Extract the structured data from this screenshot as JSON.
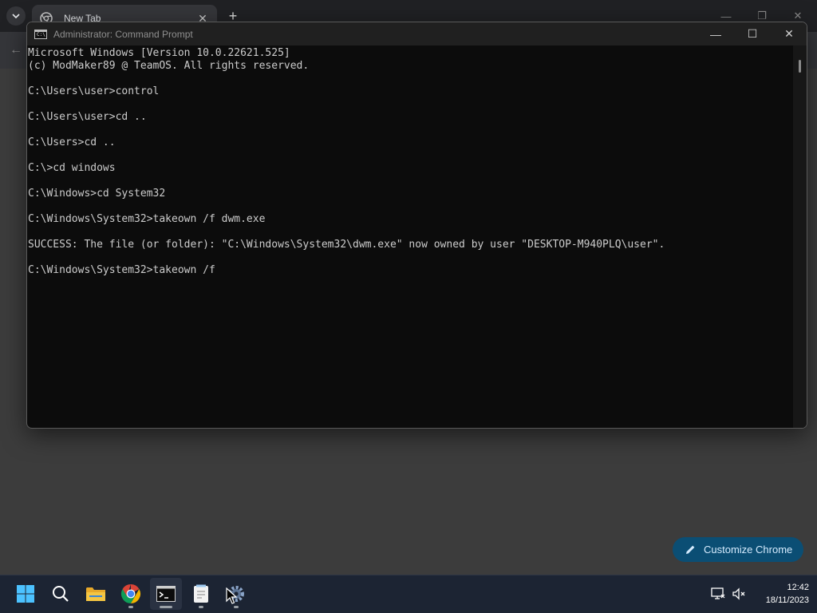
{
  "chrome": {
    "tab_title": "New Tab",
    "tab_close": "✕",
    "new_tab": "+",
    "back": "←",
    "win_minimize": "—",
    "win_restore": "❐",
    "win_close": "✕",
    "customize_label": "Customize Chrome"
  },
  "cmd": {
    "title": "Administrator: Command Prompt",
    "minimize": "—",
    "maximize": "☐",
    "close": "✕",
    "lines": [
      "Microsoft Windows [Version 10.0.22621.525]",
      "(c) ModMaker89 @ TeamOS. All rights reserved.",
      "",
      "C:\\Users\\user>control",
      "",
      "C:\\Users\\user>cd ..",
      "",
      "C:\\Users>cd ..",
      "",
      "C:\\>cd windows",
      "",
      "C:\\Windows>cd System32",
      "",
      "C:\\Windows\\System32>takeown /f dwm.exe",
      "",
      "SUCCESS: The file (or folder): \"C:\\Windows\\System32\\dwm.exe\" now owned by user \"DESKTOP-M940PLQ\\user\".",
      "",
      "C:\\Windows\\System32>takeown /f"
    ]
  },
  "taskbar": {
    "items": [
      {
        "name": "start-icon"
      },
      {
        "name": "search-icon"
      },
      {
        "name": "file-explorer-icon"
      },
      {
        "name": "chrome-icon"
      },
      {
        "name": "command-prompt-icon"
      },
      {
        "name": "notepad-icon"
      },
      {
        "name": "settings-icon"
      }
    ],
    "tray": [
      "network-icon",
      "volume-muted-icon"
    ],
    "time": "12:42",
    "date": "18/11/2023"
  },
  "colors": {
    "cmd_bg": "#0c0c0c",
    "cmd_text": "#cccccc",
    "taskbar_bg": "#1c2433",
    "accent_button": "#0b4e74"
  }
}
